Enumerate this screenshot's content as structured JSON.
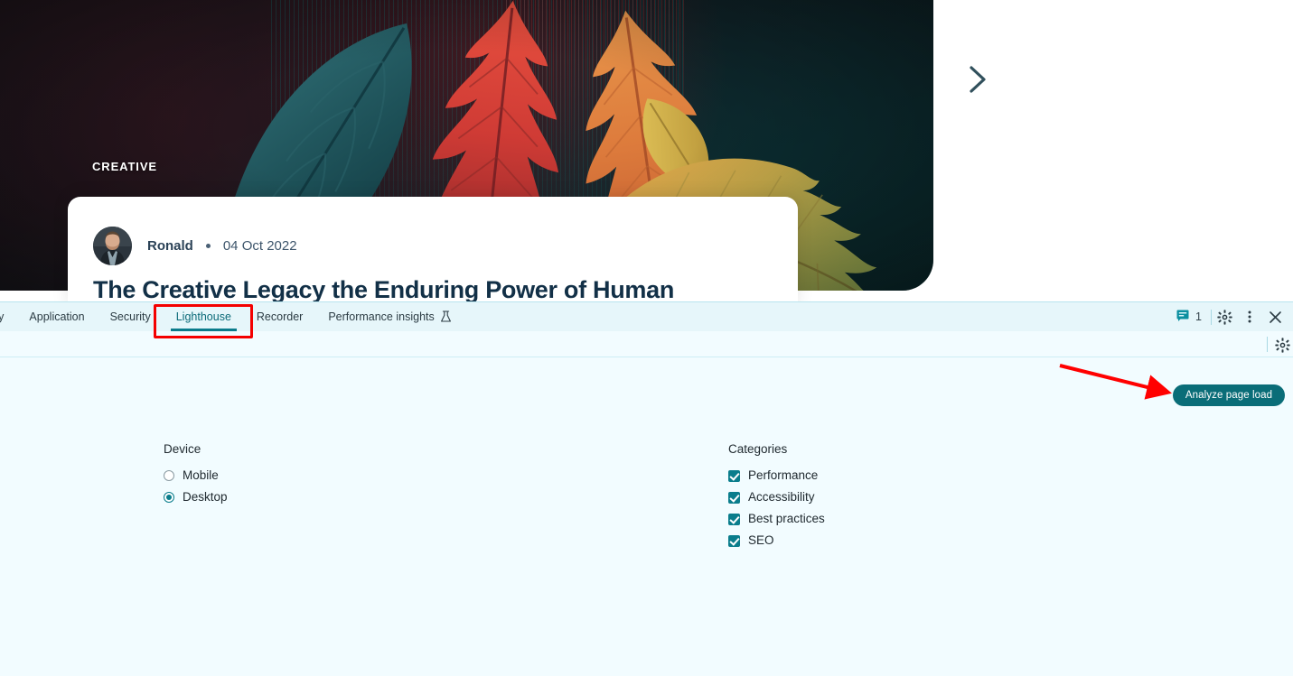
{
  "webpage": {
    "eyebrow": "CREATIVE",
    "author": "Ronald",
    "date": "04 Oct 2022",
    "title": "The Creative Legacy the Enduring Power of Human",
    "next_arrow_icon": "chevron-right-icon",
    "avatar_alt": "author-avatar"
  },
  "devtools": {
    "tabs": [
      {
        "label": "ry",
        "active": false,
        "clipped": true
      },
      {
        "label": "Application",
        "active": false,
        "clipped": false
      },
      {
        "label": "Security",
        "active": false,
        "clipped": false
      },
      {
        "label": "Lighthouse",
        "active": true,
        "clipped": false
      },
      {
        "label": "Recorder",
        "active": false,
        "clipped": false
      },
      {
        "label": "Performance insights",
        "active": false,
        "clipped": false,
        "icon": "flask-icon"
      }
    ],
    "issues_count": "1",
    "issues_icon": "issues-message-icon",
    "settings_icon": "gear-icon",
    "more_icon": "three-dots-vertical-icon",
    "close_icon": "close-x-icon",
    "subbar_settings_icon": "gear-icon"
  },
  "lighthouse": {
    "analyze_button": "Analyze page load",
    "device": {
      "title": "Device",
      "options": [
        {
          "label": "Mobile",
          "selected": false
        },
        {
          "label": "Desktop",
          "selected": true
        }
      ]
    },
    "categories": {
      "title": "Categories",
      "options": [
        {
          "label": "Performance",
          "checked": true
        },
        {
          "label": "Accessibility",
          "checked": true
        },
        {
          "label": "Best practices",
          "checked": true
        },
        {
          "label": "SEO",
          "checked": true
        }
      ]
    }
  },
  "annotations": {
    "highlight_color": "#f40000",
    "arrow_color": "#ff0000"
  }
}
